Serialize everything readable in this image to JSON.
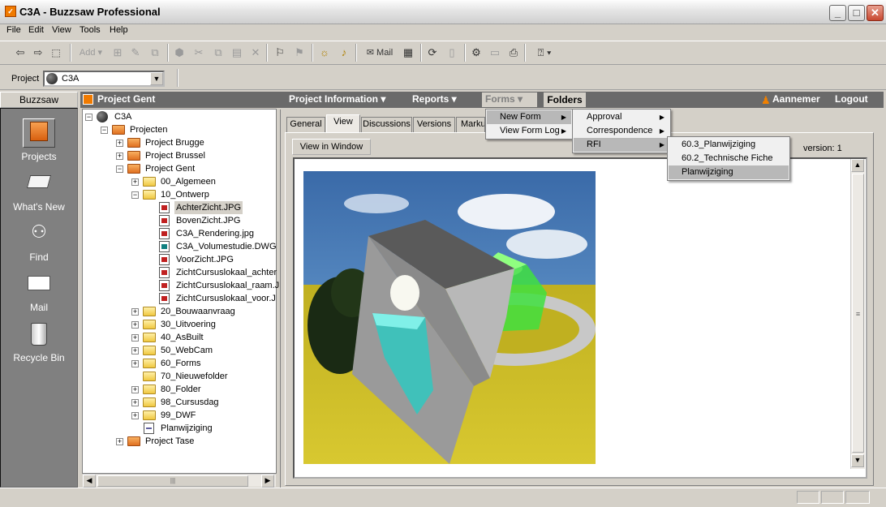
{
  "window": {
    "title": "C3A - Buzzsaw Professional",
    "icon_glyph": "✓",
    "min": "_",
    "max": "□",
    "close": "✕"
  },
  "menubar": [
    "File",
    "Edit",
    "View",
    "Tools",
    "Help"
  ],
  "toolbar": {
    "add_label": "Add",
    "mail_label": "Mail"
  },
  "projectbar": {
    "label": "Project",
    "selected": "C3A"
  },
  "sidebar": {
    "header": "Buzzsaw",
    "items": [
      {
        "label": "Projects",
        "icon": "projects-icon"
      },
      {
        "label": "What's New",
        "icon": "news-icon"
      },
      {
        "label": "Find",
        "icon": "binoculars-icon"
      },
      {
        "label": "Mail",
        "icon": "envelope-icon"
      },
      {
        "label": "Recycle Bin",
        "icon": "recycle-bin-icon"
      }
    ]
  },
  "header": {
    "project_title": "Project Gent",
    "nav": [
      "Project Information ▾",
      "Reports ▾",
      "Forms ▾",
      "Folders"
    ],
    "user": "Aannemer",
    "logout": "Logout"
  },
  "tree": [
    {
      "label": "C3A",
      "exp": "−",
      "type": "globe"
    },
    {
      "label": "Projecten",
      "exp": "−",
      "type": "orange"
    },
    {
      "label": "Project Brugge",
      "exp": "+",
      "type": "orange"
    },
    {
      "label": "Project Brussel",
      "exp": "+",
      "type": "orange"
    },
    {
      "label": "Project Gent",
      "exp": "−",
      "type": "orange"
    },
    {
      "label": "00_Algemeen",
      "exp": "+",
      "type": "yellow"
    },
    {
      "label": "10_Ontwerp",
      "exp": "−",
      "type": "yellow"
    },
    {
      "label": "AchterZicht.JPG",
      "exp": "",
      "type": "img"
    },
    {
      "label": "BovenZicht.JPG",
      "exp": "",
      "type": "img"
    },
    {
      "label": "C3A_Rendering.jpg",
      "exp": "",
      "type": "img"
    },
    {
      "label": "C3A_Volumestudie.DWG",
      "exp": "",
      "type": "dwg"
    },
    {
      "label": "VoorZicht.JPG",
      "exp": "",
      "type": "img"
    },
    {
      "label": "ZichtCursuslokaal_achter",
      "exp": "",
      "type": "img"
    },
    {
      "label": "ZichtCursuslokaal_raam.J",
      "exp": "",
      "type": "img"
    },
    {
      "label": "ZichtCursuslokaal_voor.J",
      "exp": "",
      "type": "img"
    },
    {
      "label": "20_Bouwaanvraag",
      "exp": "+",
      "type": "yellow"
    },
    {
      "label": "30_Uitvoering",
      "exp": "+",
      "type": "yellow"
    },
    {
      "label": "40_AsBuilt",
      "exp": "+",
      "type": "yellow"
    },
    {
      "label": "50_WebCam",
      "exp": "+",
      "type": "yellow"
    },
    {
      "label": "60_Forms",
      "exp": "+",
      "type": "yellow"
    },
    {
      "label": "70_Nieuwefolder",
      "exp": "",
      "type": "yellow"
    },
    {
      "label": "80_Folder",
      "exp": "+",
      "type": "yellow"
    },
    {
      "label": "98_Cursusdag",
      "exp": "+",
      "type": "yellow"
    },
    {
      "label": "99_DWF",
      "exp": "+",
      "type": "yellow"
    },
    {
      "label": "Planwijziging",
      "exp": "",
      "type": "doc"
    },
    {
      "label": "Project Tase",
      "exp": "+",
      "type": "orange"
    }
  ],
  "tabs": [
    "General",
    "View",
    "Discussions",
    "Versions",
    "Marku"
  ],
  "view": {
    "button": "View in Window",
    "version": "version: 1"
  },
  "menus": {
    "forms": [
      {
        "label": "New Form",
        "sub": true
      },
      {
        "label": "View Form Log",
        "sub": true
      }
    ],
    "new_form": [
      {
        "label": "Approval",
        "sub": true
      },
      {
        "label": "Correspondence",
        "sub": true
      },
      {
        "label": "RFI",
        "sub": true
      }
    ],
    "rfi": [
      {
        "label": "60.3_Planwijziging"
      },
      {
        "label": "60.2_Technische Fiche"
      },
      {
        "label": "Planwijziging"
      }
    ]
  },
  "scroll": {
    "up": "▲",
    "down": "▼",
    "left": "◀",
    "right": "▶",
    "grip": "≡",
    "hgrip": "|||"
  }
}
